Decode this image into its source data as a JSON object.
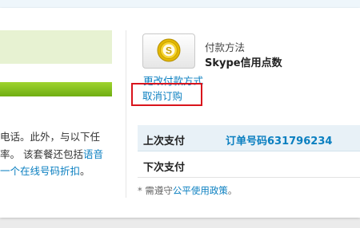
{
  "left": {
    "line1": "电话。此外，与以下任",
    "line2_plain": "率。 该套餐还包括",
    "line2_link": "语音",
    "line3_link": "一个在线号码折扣",
    "line3_end": "。"
  },
  "payment": {
    "method_label": "付款方法",
    "method_value": "Skype信用点数",
    "change_link": "更改付款方式",
    "cancel_link": "取消订购",
    "icon": "skype-coin-icon"
  },
  "table": {
    "last_label": "上次支付",
    "last_order": "订单号码631796234",
    "next_label": "下次支付"
  },
  "footnote": {
    "prefix": "* 需遵守",
    "link": "公平使用政策",
    "suffix": "。"
  },
  "colors": {
    "link": "#0a7fc0",
    "highlight_border": "#d9141c",
    "green": "#7dbb1c"
  }
}
